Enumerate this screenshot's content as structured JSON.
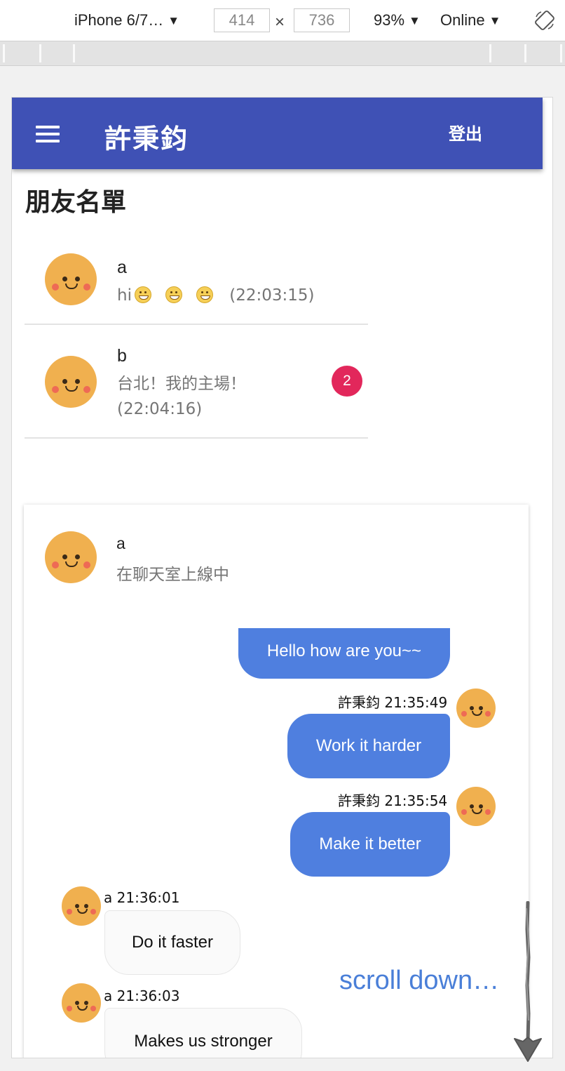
{
  "devtools": {
    "device": "iPhone 6/7…",
    "width": "414",
    "height": "736",
    "times": "×",
    "zoom": "93%",
    "network": "Online",
    "dropdown_glyph": "▼"
  },
  "app": {
    "title": "許秉鈞",
    "logout_label": "登出",
    "header_color": "#3f51b5"
  },
  "friends_section": {
    "title": "朋友名單",
    "friends": [
      {
        "name": "a",
        "message_prefix": "hi",
        "time": "(22:03:15)",
        "emoji_count": 3
      },
      {
        "name": "b",
        "message": "台北！我的主場！",
        "time": "(22:04:16)",
        "unread": "2"
      }
    ]
  },
  "chat": {
    "partner_name": "a",
    "partner_status": "在聊天室上線中",
    "messages": [
      {
        "direction": "out",
        "text": "Hello how are you~~"
      },
      {
        "direction": "out",
        "sender": "許秉鈞",
        "time": "21:35:49",
        "text": "Work it harder"
      },
      {
        "direction": "out",
        "sender": "許秉鈞",
        "time": "21:35:54",
        "text": "Make it better"
      },
      {
        "direction": "in",
        "sender": "a",
        "time": "21:36:01",
        "text": "Do it faster"
      },
      {
        "direction": "in",
        "sender": "a",
        "time": "21:36:03",
        "text": "Makes us stronger"
      }
    ],
    "out_bubble_color": "#4f7fdf"
  },
  "annotation": {
    "text": "scroll down…",
    "color": "#4a7fd8"
  }
}
